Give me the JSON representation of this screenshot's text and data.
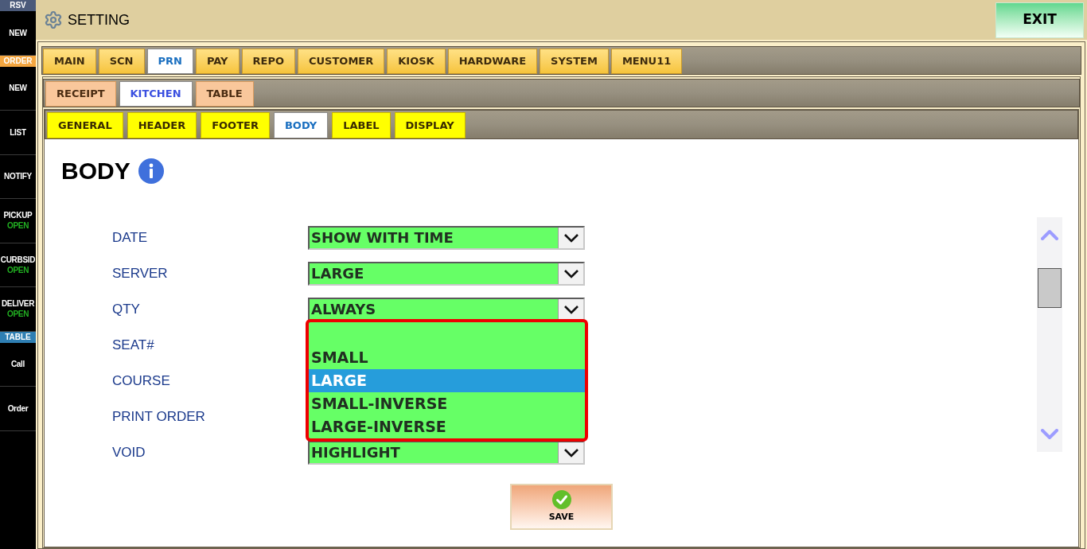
{
  "sidebar": [
    {
      "kind": "header",
      "label": "RSV",
      "color": "#4b5a7a"
    },
    {
      "kind": "item",
      "label": "NEW"
    },
    {
      "kind": "header",
      "label": "ORDER",
      "color": "#f4a640"
    },
    {
      "kind": "item",
      "label": "NEW"
    },
    {
      "kind": "item",
      "label": "LIST"
    },
    {
      "kind": "item",
      "label": "NOTIFY"
    },
    {
      "kind": "item",
      "label": "PICKUP",
      "status": "OPEN"
    },
    {
      "kind": "item",
      "label": "CURBSID",
      "status": "OPEN"
    },
    {
      "kind": "item",
      "label": "DELIVER",
      "status": "OPEN"
    },
    {
      "kind": "header",
      "label": "TABLE",
      "color": "#2f7fb3"
    },
    {
      "kind": "item",
      "label": "Call"
    },
    {
      "kind": "item",
      "label": "Order"
    }
  ],
  "window": {
    "title": "SETTING",
    "exit_button": "EXIT"
  },
  "main_tabs": [
    {
      "label": "MAIN",
      "selected": false
    },
    {
      "label": "SCN",
      "selected": false
    },
    {
      "label": "PRN",
      "selected": true
    },
    {
      "label": "PAY",
      "selected": false
    },
    {
      "label": "REPO",
      "selected": false
    },
    {
      "label": "CUSTOMER",
      "selected": false
    },
    {
      "label": "KIOSK",
      "selected": false
    },
    {
      "label": "HARDWARE",
      "selected": false
    },
    {
      "label": "SYSTEM",
      "selected": false
    },
    {
      "label": "MENU11",
      "selected": false
    }
  ],
  "sub_tabs": [
    {
      "label": "RECEIPT",
      "selected": false
    },
    {
      "label": "KITCHEN",
      "selected": true
    },
    {
      "label": "TABLE",
      "selected": false
    }
  ],
  "section_tabs": [
    {
      "label": "GENERAL",
      "selected": false
    },
    {
      "label": "HEADER",
      "selected": false
    },
    {
      "label": "FOOTER",
      "selected": false
    },
    {
      "label": "BODY",
      "selected": true
    },
    {
      "label": "LABEL",
      "selected": false
    },
    {
      "label": "DISPLAY",
      "selected": false
    }
  ],
  "section": {
    "heading": "BODY",
    "fields": [
      {
        "label": "DATE",
        "value": "SHOW WITH TIME"
      },
      {
        "label": "SERVER",
        "value": "LARGE"
      },
      {
        "label": "QTY",
        "value": "ALWAYS"
      },
      {
        "label": "SEAT#"
      },
      {
        "label": "COURSE"
      },
      {
        "label": "PRINT ORDER"
      },
      {
        "label": "VOID",
        "value": "HIGHLIGHT"
      }
    ],
    "dropdown": {
      "options": [
        {
          "label": "SMALL",
          "selected": false
        },
        {
          "label": "LARGE",
          "selected": true
        },
        {
          "label": "SMALL-INVERSE",
          "selected": false
        },
        {
          "label": "LARGE-INVERSE",
          "selected": false
        }
      ]
    }
  },
  "save_button": "SAVE"
}
